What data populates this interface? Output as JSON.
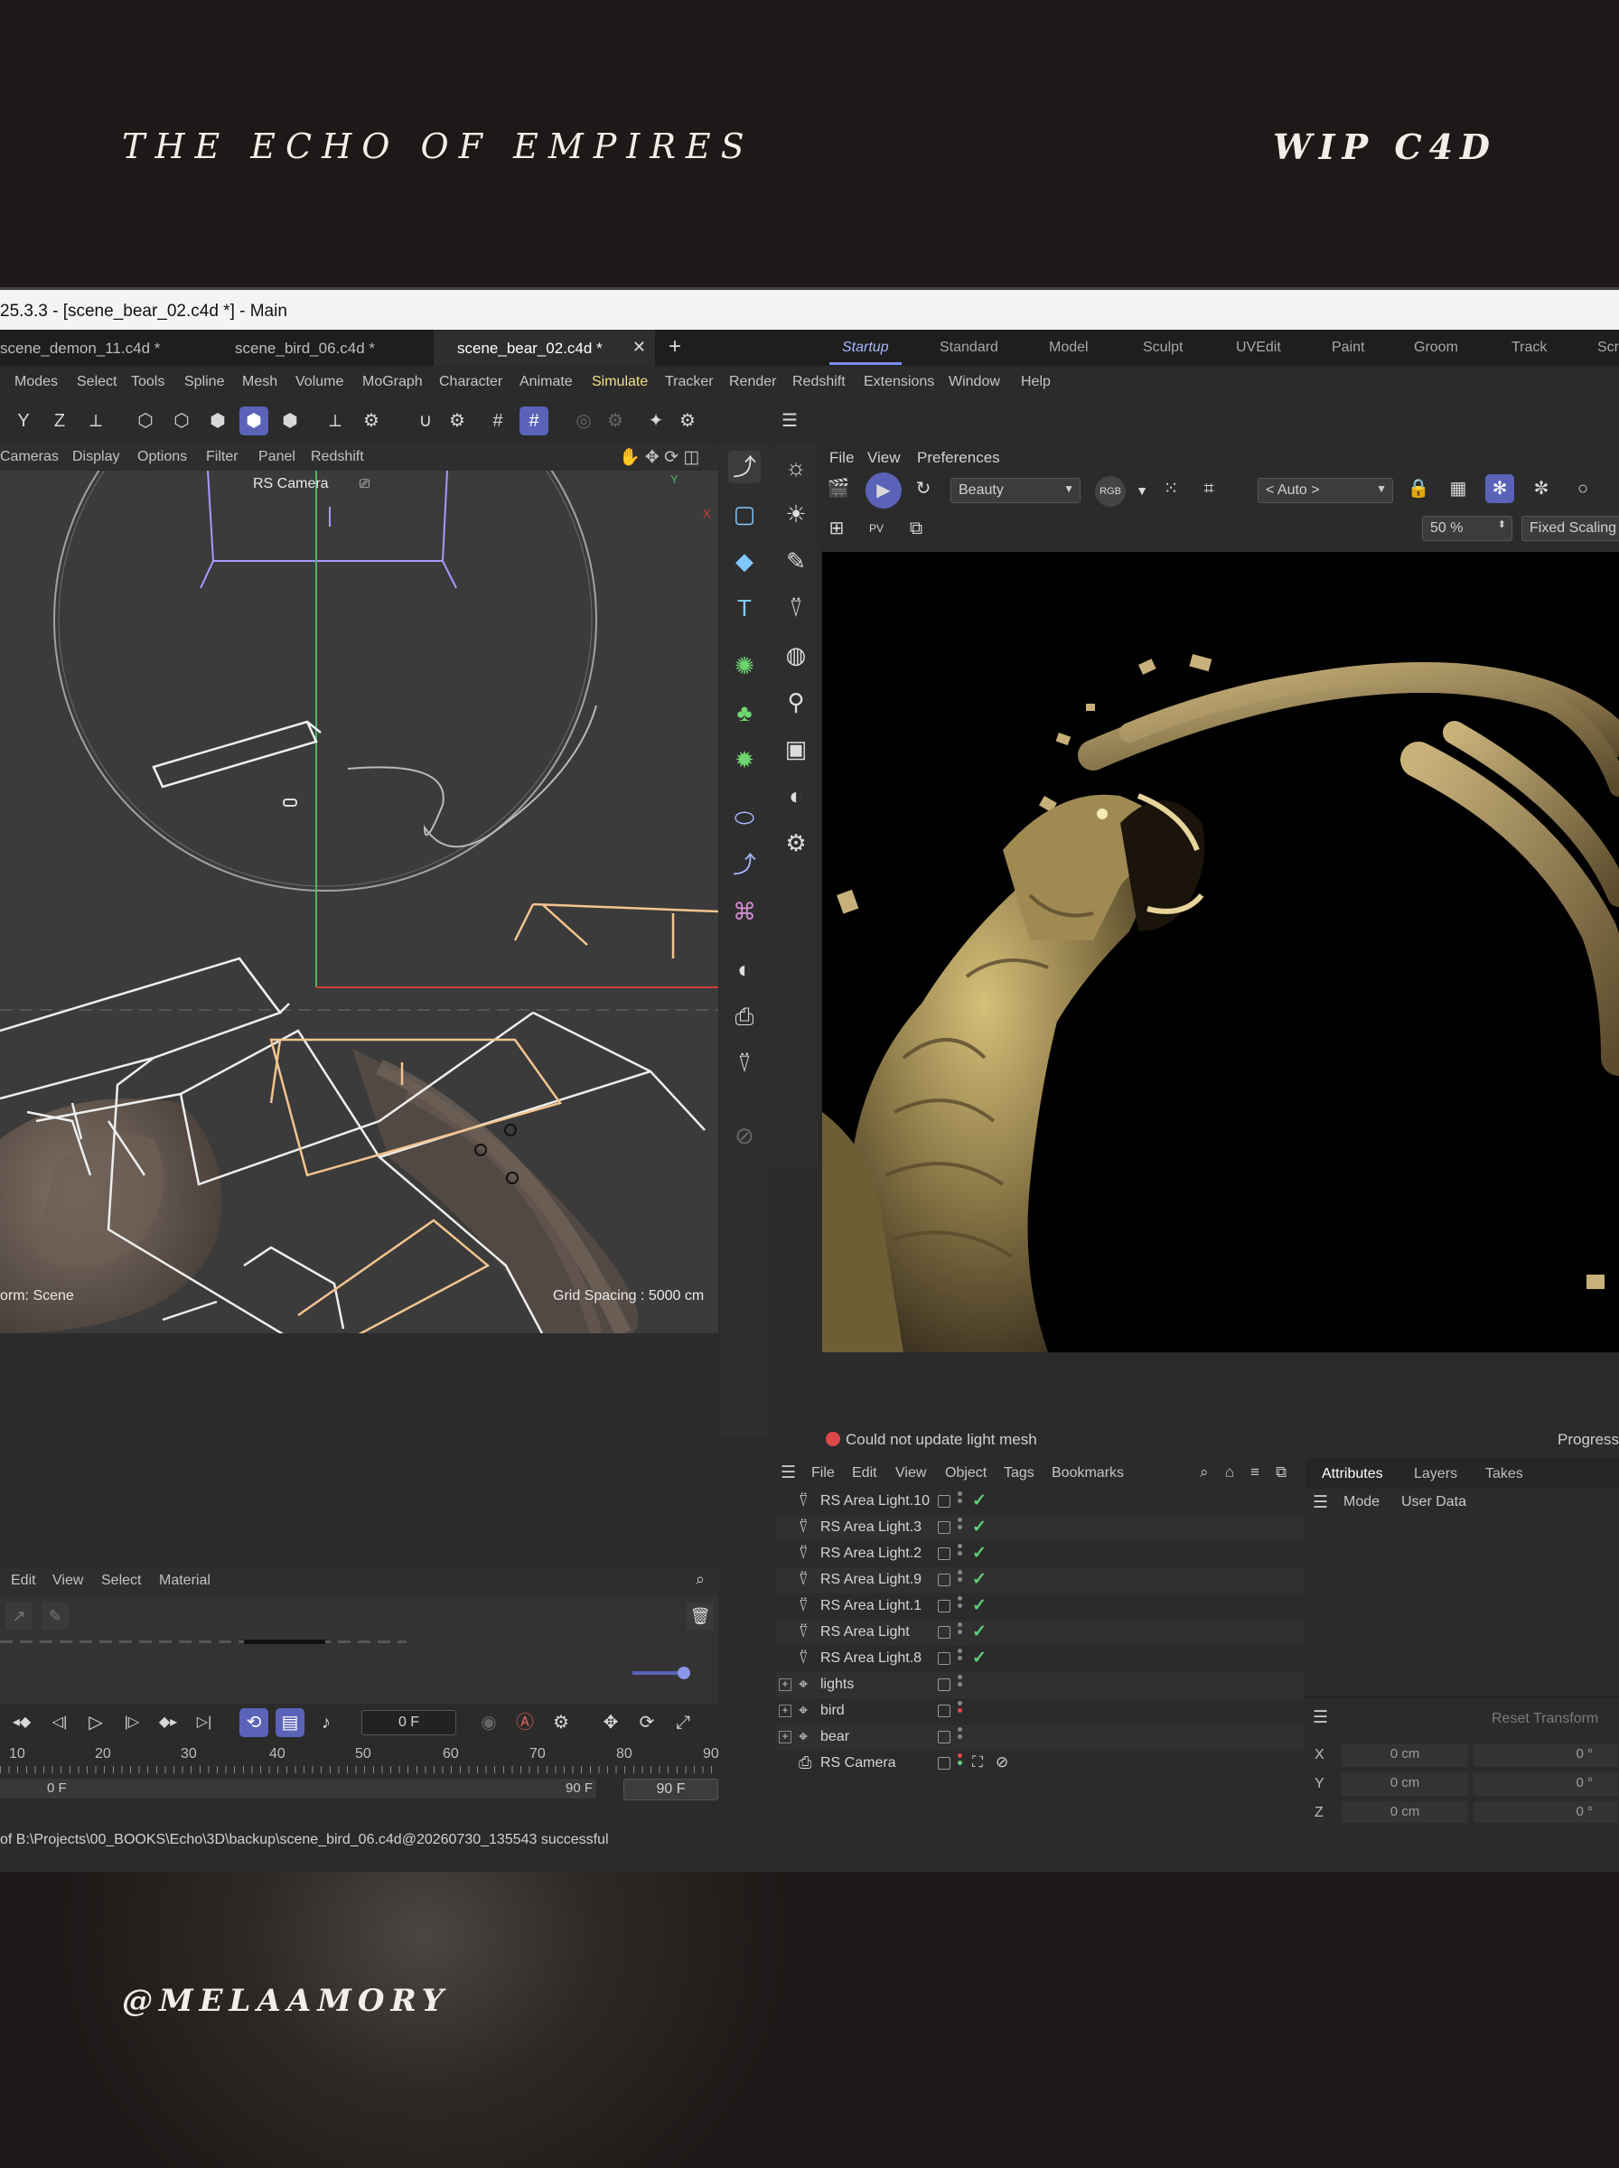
{
  "poster": {
    "title": "THE ECHO OF EMPIRES",
    "tag": "WIP C4D",
    "handle": "@MELAAMORY"
  },
  "window": {
    "title": "25.3.3 - [scene_bear_02.c4d *] - Main",
    "doc_tabs": [
      {
        "label": "scene_demon_11.c4d *"
      },
      {
        "label": "scene_bird_06.c4d *"
      },
      {
        "label": "scene_bear_02.c4d *",
        "active": true
      }
    ],
    "close_glyph": "✕",
    "add_glyph": "+",
    "layouts": [
      "Startup",
      "Standard",
      "Model",
      "Sculpt",
      "UVEdit",
      "Paint",
      "Groom",
      "Track",
      "Scri"
    ],
    "menu": [
      "Modes",
      "Select",
      "Tools",
      "Spline",
      "Mesh",
      "Volume",
      "MoGraph",
      "Character",
      "Animate",
      "Simulate",
      "Tracker",
      "Render",
      "Redshift",
      "Extensions",
      "Window",
      "Help"
    ],
    "axis_labels": [
      "Y",
      "Z"
    ]
  },
  "viewport": {
    "menu": [
      "Cameras",
      "Display",
      "Options",
      "Filter",
      "Panel",
      "Redshift"
    ],
    "camera_label": "RS Camera",
    "transform_label": "orm: Scene",
    "grid_spacing": "Grid Spacing : 5000 cm",
    "axis_y": "Y",
    "axis_x": "X"
  },
  "material": {
    "menu": [
      "Edit",
      "View",
      "Select",
      "Material"
    ]
  },
  "timeline": {
    "current_frame": "0 F",
    "ruler": [
      "10",
      "20",
      "30",
      "40",
      "50",
      "60",
      "70",
      "80",
      "90"
    ],
    "start_frame": "0 F",
    "end_frame": "90 F",
    "end_frame_box": "90 F"
  },
  "render_view": {
    "menu": [
      "File",
      "View",
      "Preferences"
    ],
    "aov": "Beauty",
    "rgb_label": "RGB",
    "camera_select": "< Auto >",
    "zoom": "50 %",
    "scaling": "Fixed Scaling",
    "pv_label": "PV",
    "status_error": "Could not update light mesh",
    "progress_label": "Progress"
  },
  "object_manager": {
    "menu": [
      "File",
      "Edit",
      "View",
      "Object",
      "Tags",
      "Bookmarks"
    ],
    "rows": [
      {
        "name": "RS Area Light.10",
        "type": "light",
        "check": true
      },
      {
        "name": "RS Area Light.3",
        "type": "light",
        "check": true
      },
      {
        "name": "RS Area Light.2",
        "type": "light",
        "check": true
      },
      {
        "name": "RS Area Light.9",
        "type": "light",
        "check": true
      },
      {
        "name": "RS Area Light.1",
        "type": "light",
        "check": true
      },
      {
        "name": "RS Area Light",
        "type": "light",
        "check": true
      },
      {
        "name": "RS Area Light.8",
        "type": "light",
        "check": true
      },
      {
        "name": "lights",
        "type": "null",
        "check": false
      },
      {
        "name": "bird",
        "type": "null",
        "check": false
      },
      {
        "name": "bear",
        "type": "null",
        "check": false
      },
      {
        "name": "RS Camera",
        "type": "camera",
        "check": false
      }
    ]
  },
  "attributes": {
    "tabs": [
      "Attributes",
      "Layers",
      "Takes"
    ],
    "mode_label": "Mode",
    "user_data_label": "User Data",
    "reset_transform": "Reset Transform",
    "coords": [
      {
        "axis": "X",
        "pos": "0 cm",
        "rot": "0 °"
      },
      {
        "axis": "Y",
        "pos": "0 cm",
        "rot": "0 °"
      },
      {
        "axis": "Z",
        "pos": "0 cm",
        "rot": "0 °"
      }
    ]
  },
  "status_bar": "of B:\\Projects\\00_BOOKS\\Echo\\3D\\backup\\scene_bird_06.c4d@20260730_135543 successful",
  "colors": {
    "accent": "#7d8cff",
    "ok": "#5fd07a",
    "error": "#e04848"
  }
}
